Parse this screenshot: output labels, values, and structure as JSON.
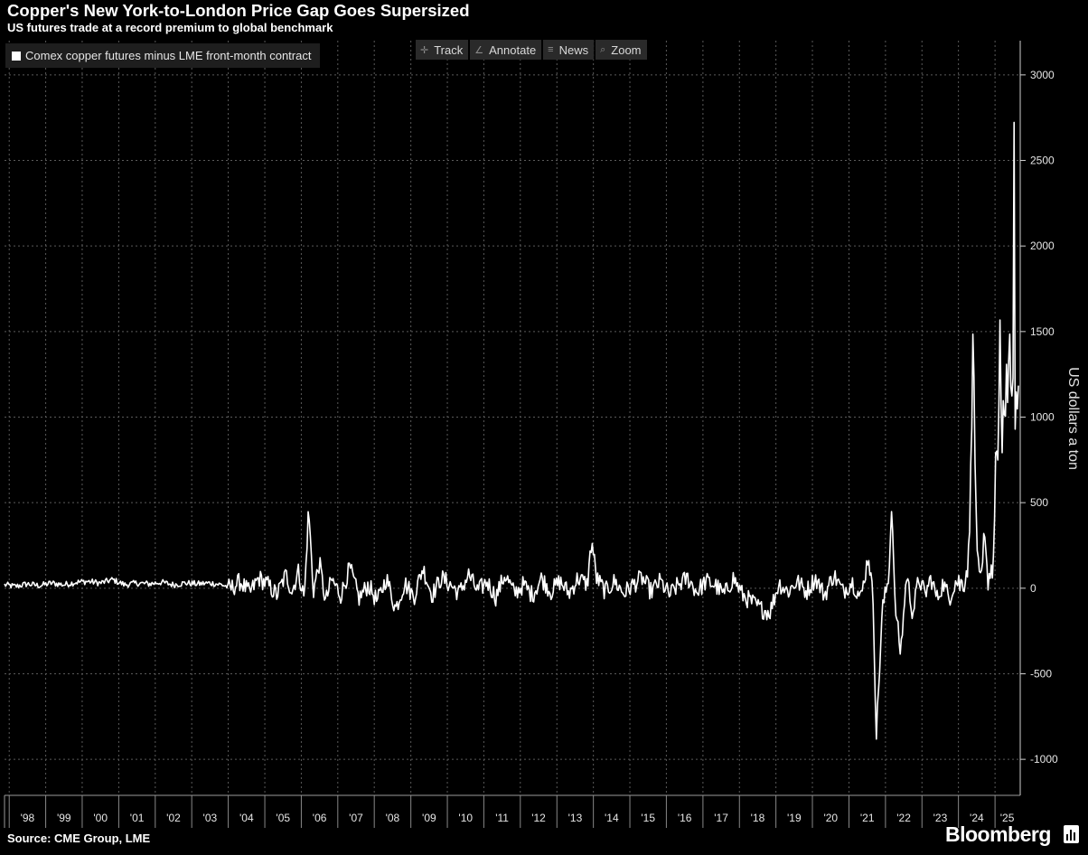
{
  "header": {
    "title": "Copper's New York-to-London Price Gap Goes Supersized",
    "subtitle": "US futures trade at a record premium to global benchmark"
  },
  "toolbar": {
    "items": [
      {
        "label": "Track",
        "icon": "crosshair-icon"
      },
      {
        "label": "Annotate",
        "icon": "pencil-icon"
      },
      {
        "label": "News",
        "icon": "list-icon"
      },
      {
        "label": "Zoom",
        "icon": "magnifier-icon"
      }
    ]
  },
  "footer": {
    "source": "Source: CME Group, LME",
    "brand": "Bloomberg"
  },
  "colors": {
    "background": "#000000",
    "series": "#ffffff",
    "grid": "#5a5a5a"
  },
  "chart_data": {
    "type": "line",
    "title": "Copper's New York-to-London Price Gap Goes Supersized",
    "subtitle": "US futures trade at a record premium to global benchmark",
    "xlabel": "",
    "ylabel": "US dollars a ton",
    "ylim": [
      -1200,
      3200
    ],
    "yticks": [
      -1000,
      -500,
      0,
      500,
      1000,
      1500,
      2000,
      2500,
      3000
    ],
    "xticks": [
      "'98",
      "'99",
      "'00",
      "'01",
      "'02",
      "'03",
      "'04",
      "'05",
      "'06",
      "'07",
      "'08",
      "'09",
      "'10",
      "'11",
      "'12",
      "'13",
      "'14",
      "'15",
      "'16",
      "'17",
      "'18",
      "'19",
      "'20",
      "'21",
      "'22",
      "'23",
      "'24",
      "'25"
    ],
    "xlim": [
      "1997-11-15",
      "2025-09-01"
    ],
    "grid": true,
    "legend_position": "top-left",
    "series": [
      {
        "name": "Comex copper futures minus LME front-month contract",
        "color": "#ffffff",
        "x": [
          "1997-11-15",
          "1998-03-01",
          "1998-07-01",
          "1998-11-01",
          "1999-03-01",
          "1999-07-01",
          "1999-11-01",
          "2000-03-01",
          "2000-07-01",
          "2000-11-01",
          "2001-03-01",
          "2001-07-01",
          "2001-11-01",
          "2002-03-01",
          "2002-07-01",
          "2002-11-01",
          "2003-03-01",
          "2003-07-01",
          "2003-11-01",
          "2004-02-01",
          "2004-05-01",
          "2004-08-01",
          "2004-11-01",
          "2005-02-01",
          "2005-05-01",
          "2005-08-01",
          "2005-10-01",
          "2005-12-01",
          "2006-02-01",
          "2006-03-15",
          "2006-05-01",
          "2006-07-01",
          "2006-09-01",
          "2006-11-01",
          "2007-02-01",
          "2007-05-01",
          "2007-08-01",
          "2007-11-01",
          "2008-02-01",
          "2008-05-01",
          "2008-08-01",
          "2008-11-01",
          "2009-02-01",
          "2009-05-01",
          "2009-08-01",
          "2009-11-01",
          "2010-02-01",
          "2010-05-01",
          "2010-08-01",
          "2010-11-01",
          "2011-02-01",
          "2011-05-01",
          "2011-08-01",
          "2011-11-01",
          "2012-02-01",
          "2012-05-01",
          "2012-08-01",
          "2012-11-01",
          "2013-02-01",
          "2013-05-01",
          "2013-08-01",
          "2013-11-01",
          "2013-12-15",
          "2014-02-01",
          "2014-05-01",
          "2014-08-01",
          "2014-11-01",
          "2015-02-01",
          "2015-05-01",
          "2015-08-01",
          "2015-11-01",
          "2016-02-01",
          "2016-05-01",
          "2016-08-01",
          "2016-11-01",
          "2017-02-01",
          "2017-05-01",
          "2017-08-01",
          "2017-11-01",
          "2018-02-01",
          "2018-05-01",
          "2018-08-01",
          "2018-11-01",
          "2019-02-01",
          "2019-05-01",
          "2019-08-01",
          "2019-11-01",
          "2020-02-01",
          "2020-05-01",
          "2020-08-01",
          "2020-11-01",
          "2021-02-01",
          "2021-05-01",
          "2021-07-15",
          "2021-09-01",
          "2021-10-01",
          "2021-12-01",
          "2022-02-01",
          "2022-03-08",
          "2022-04-01",
          "2022-06-01",
          "2022-08-01",
          "2022-10-01",
          "2022-12-01",
          "2023-02-01",
          "2023-04-01",
          "2023-06-01",
          "2023-08-01",
          "2023-10-01",
          "2023-12-01",
          "2024-02-01",
          "2024-03-15",
          "2024-04-15",
          "2024-05-10",
          "2024-05-25",
          "2024-06-15",
          "2024-07-15",
          "2024-08-15",
          "2024-09-15",
          "2024-10-15",
          "2024-11-15",
          "2024-12-15",
          "2025-01-15",
          "2025-02-01",
          "2025-02-20",
          "2025-03-10",
          "2025-03-26",
          "2025-04-10",
          "2025-04-25",
          "2025-05-10",
          "2025-05-25",
          "2025-06-10",
          "2025-06-25",
          "2025-07-05",
          "2025-07-10",
          "2025-07-20",
          "2025-08-01"
        ],
        "values": [
          20,
          10,
          25,
          15,
          30,
          20,
          35,
          40,
          30,
          50,
          20,
          30,
          25,
          35,
          20,
          30,
          25,
          30,
          20,
          0,
          40,
          -30,
          60,
          20,
          -40,
          80,
          -20,
          100,
          -60,
          470,
          -20,
          150,
          -80,
          50,
          -40,
          120,
          -60,
          20,
          -80,
          60,
          -120,
          30,
          -50,
          120,
          -40,
          60,
          20,
          -30,
          80,
          -20,
          40,
          -50,
          80,
          -30,
          20,
          -40,
          60,
          -20,
          40,
          -30,
          60,
          20,
          280,
          60,
          -20,
          40,
          -30,
          20,
          60,
          -20,
          40,
          -40,
          20,
          60,
          -20,
          40,
          20,
          -40,
          60,
          -40,
          -80,
          -120,
          -140,
          30,
          -20,
          40,
          -20,
          60,
          -40,
          80,
          -20,
          40,
          -60,
          200,
          -80,
          -870,
          -120,
          60,
          520,
          -60,
          -380,
          80,
          -150,
          60,
          -40,
          60,
          -60,
          30,
          -60,
          40,
          20,
          80,
          200,
          850,
          1600,
          700,
          100,
          -20,
          300,
          60,
          100,
          150,
          900,
          700,
          1550,
          600,
          1200,
          900,
          1300,
          1000,
          1500,
          1150,
          1200,
          1300,
          2800,
          1000,
          1100
        ]
      }
    ]
  }
}
